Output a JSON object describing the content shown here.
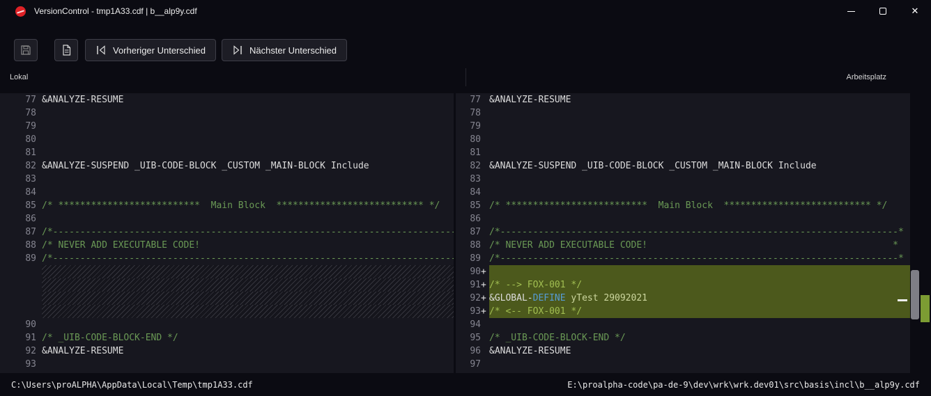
{
  "window": {
    "title": "VersionControl - tmp1A33.cdf | b__alp9y.cdf",
    "controls": {
      "close_glyph": "✕"
    }
  },
  "toolbar": {
    "prev_label": "Vorheriger Unterschied",
    "next_label": "Nächster Unterschied"
  },
  "panes": {
    "left_header": "Lokal",
    "right_header": "Arbeitsplatz"
  },
  "statusbar": {
    "left_path": "C:\\Users\\proALPHA\\AppData\\Local\\Temp\\tmp1A33.cdf",
    "right_path": "E:\\proalpha-code\\pa-de-9\\dev\\wrk\\wrk.dev01\\src\\basis\\incl\\b__alp9y.cdf"
  },
  "colors": {
    "plain": "#dcdcdc",
    "comment": "#6a9955",
    "keyword": "#569cd6",
    "pale": "#ccd69e",
    "added_comment": "#a2bf52",
    "added_bg": "#4c591c",
    "brand_red": "#de2126"
  },
  "left_code": {
    "lines": [
      {
        "num": "77",
        "segs": [
          {
            "t": "&ANALYZE-RESUME",
            "c": "plain"
          }
        ]
      },
      {
        "num": "78",
        "segs": []
      },
      {
        "num": "79",
        "segs": []
      },
      {
        "num": "80",
        "segs": []
      },
      {
        "num": "81",
        "segs": []
      },
      {
        "num": "82",
        "segs": [
          {
            "t": "&ANALYZE-SUSPEND _UIB-CODE-BLOCK _CUSTOM _MAIN-BLOCK Include",
            "c": "plain"
          }
        ]
      },
      {
        "num": "83",
        "segs": []
      },
      {
        "num": "84",
        "segs": []
      },
      {
        "num": "85",
        "segs": [
          {
            "t": "/* **************************  Main Block  *************************** */",
            "c": "comment"
          }
        ]
      },
      {
        "num": "86",
        "segs": []
      },
      {
        "num": "87",
        "segs": [
          {
            "t": "/*----------------------------------------------------------------------------------------------------",
            "c": "comment"
          }
        ]
      },
      {
        "num": "88",
        "segs": [
          {
            "t": "/* NEVER ADD EXECUTABLE CODE!",
            "c": "comment"
          }
        ]
      },
      {
        "num": "89",
        "segs": [
          {
            "t": "/*----------------------------------------------------------------------------------------------------",
            "c": "comment"
          }
        ]
      },
      {
        "type": "filler",
        "segs": []
      },
      {
        "type": "filler",
        "segs": []
      },
      {
        "type": "filler",
        "segs": []
      },
      {
        "type": "filler",
        "segs": []
      },
      {
        "num": "90",
        "segs": []
      },
      {
        "num": "91",
        "segs": [
          {
            "t": "/* _UIB-CODE-BLOCK-END */",
            "c": "comment"
          }
        ]
      },
      {
        "num": "92",
        "segs": [
          {
            "t": "&ANALYZE-RESUME",
            "c": "plain"
          }
        ]
      },
      {
        "num": "93",
        "segs": []
      }
    ]
  },
  "right_code": {
    "lines": [
      {
        "num": "77",
        "segs": [
          {
            "t": "&ANALYZE-RESUME",
            "c": "plain"
          }
        ]
      },
      {
        "num": "78",
        "segs": []
      },
      {
        "num": "79",
        "segs": []
      },
      {
        "num": "80",
        "segs": []
      },
      {
        "num": "81",
        "segs": []
      },
      {
        "num": "82",
        "segs": [
          {
            "t": "&ANALYZE-SUSPEND _UIB-CODE-BLOCK _CUSTOM _MAIN-BLOCK Include",
            "c": "plain"
          }
        ]
      },
      {
        "num": "83",
        "segs": []
      },
      {
        "num": "84",
        "segs": []
      },
      {
        "num": "85",
        "segs": [
          {
            "t": "/* **************************  Main Block  *************************** */",
            "c": "comment"
          }
        ]
      },
      {
        "num": "86",
        "segs": []
      },
      {
        "num": "87",
        "segs": [
          {
            "t": "/*-------------------------------------------------------------------------*",
            "c": "comment"
          }
        ]
      },
      {
        "num": "88",
        "segs": [
          {
            "t": "/* NEVER ADD EXECUTABLE CODE!                                             *",
            "c": "comment"
          }
        ]
      },
      {
        "num": "89",
        "segs": [
          {
            "t": "/*-------------------------------------------------------------------------*",
            "c": "comment"
          }
        ]
      },
      {
        "num": "90",
        "mark": "+",
        "type": "added",
        "segs": []
      },
      {
        "num": "91",
        "mark": "+",
        "type": "added",
        "segs": [
          {
            "t": "/* --> FOX-001 */",
            "c": "added_comment"
          }
        ]
      },
      {
        "num": "92",
        "mark": "+",
        "type": "added",
        "segs": [
          {
            "t": "&GLOBAL-",
            "c": "plain"
          },
          {
            "t": "DEFINE",
            "c": "keyword"
          },
          {
            "t": " yTest 29092021",
            "c": "pale"
          }
        ]
      },
      {
        "num": "93",
        "mark": "+",
        "type": "added",
        "segs": [
          {
            "t": "/* <-- FOX-001 */",
            "c": "added_comment"
          }
        ]
      },
      {
        "num": "94",
        "segs": []
      },
      {
        "num": "95",
        "segs": [
          {
            "t": "/* _UIB-CODE-BLOCK-END */",
            "c": "comment"
          }
        ]
      },
      {
        "num": "96",
        "segs": [
          {
            "t": "&ANALYZE-RESUME",
            "c": "plain"
          }
        ]
      },
      {
        "num": "97",
        "segs": []
      }
    ]
  }
}
